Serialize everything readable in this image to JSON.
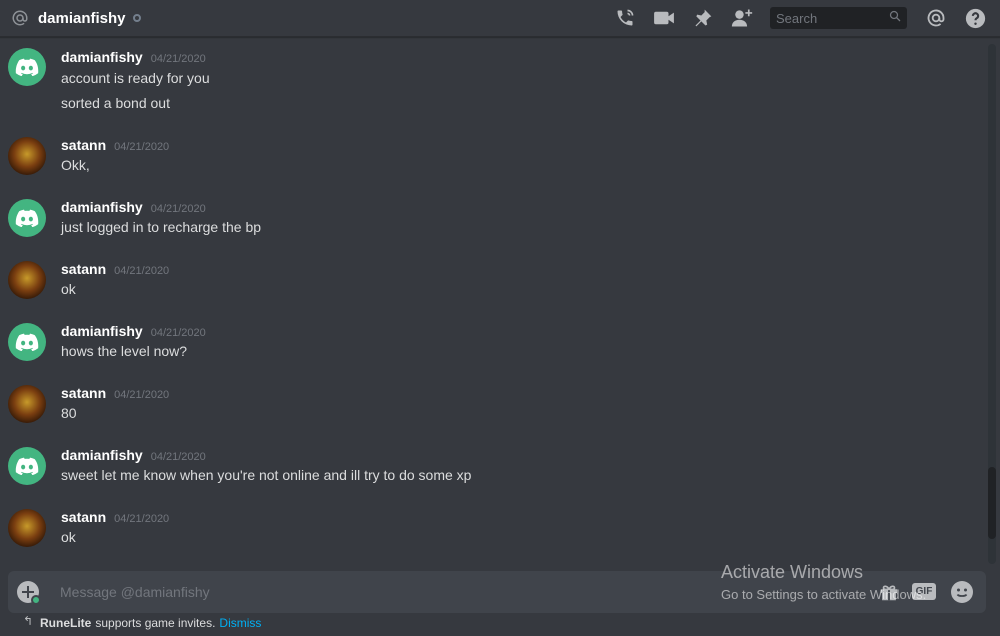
{
  "header": {
    "channel_name": "damianfishy",
    "icons": [
      "at-icon",
      "phone-call-icon",
      "video-call-icon",
      "pin-icon",
      "add-friend-icon",
      "search-icon",
      "mention-icon",
      "help-icon"
    ],
    "search_placeholder": "Search"
  },
  "messages": [
    {
      "username": "damianfishy",
      "timestamp": "04/21/2020",
      "avatar": "discord-default",
      "lines": [
        "account is ready for you",
        "sorted a bond out"
      ]
    },
    {
      "username": "satann",
      "timestamp": "04/21/2020",
      "avatar": "satann",
      "lines": [
        "Okk,"
      ]
    },
    {
      "username": "damianfishy",
      "timestamp": "04/21/2020",
      "avatar": "discord-default",
      "lines": [
        "just logged in to recharge the bp"
      ]
    },
    {
      "username": "satann",
      "timestamp": "04/21/2020",
      "avatar": "satann",
      "lines": [
        "ok"
      ]
    },
    {
      "username": "damianfishy",
      "timestamp": "04/21/2020",
      "avatar": "discord-default",
      "lines": [
        "hows the level now?"
      ]
    },
    {
      "username": "satann",
      "timestamp": "04/21/2020",
      "avatar": "satann",
      "lines": [
        "80"
      ]
    },
    {
      "username": "damianfishy",
      "timestamp": "04/21/2020",
      "avatar": "discord-default",
      "lines": [
        "sweet let me know when you're not online and ill try to do some xp"
      ]
    },
    {
      "username": "satann",
      "timestamp": "04/21/2020",
      "avatar": "satann",
      "lines": [
        "ok"
      ]
    }
  ],
  "composer": {
    "placeholder": "Message @damianfishy",
    "gif_label": "GIF"
  },
  "watermark": {
    "title": "Activate Windows",
    "subtitle": "Go to Settings to activate Windows."
  },
  "notice": {
    "app": "RuneLite",
    "text": "supports game invites.",
    "dismiss": "Dismiss"
  },
  "colors": {
    "background": "#36393f",
    "header_text": "#ffffff",
    "timestamp": "#72767d",
    "discord_avatar": "#43b581",
    "link": "#00b0f4"
  }
}
